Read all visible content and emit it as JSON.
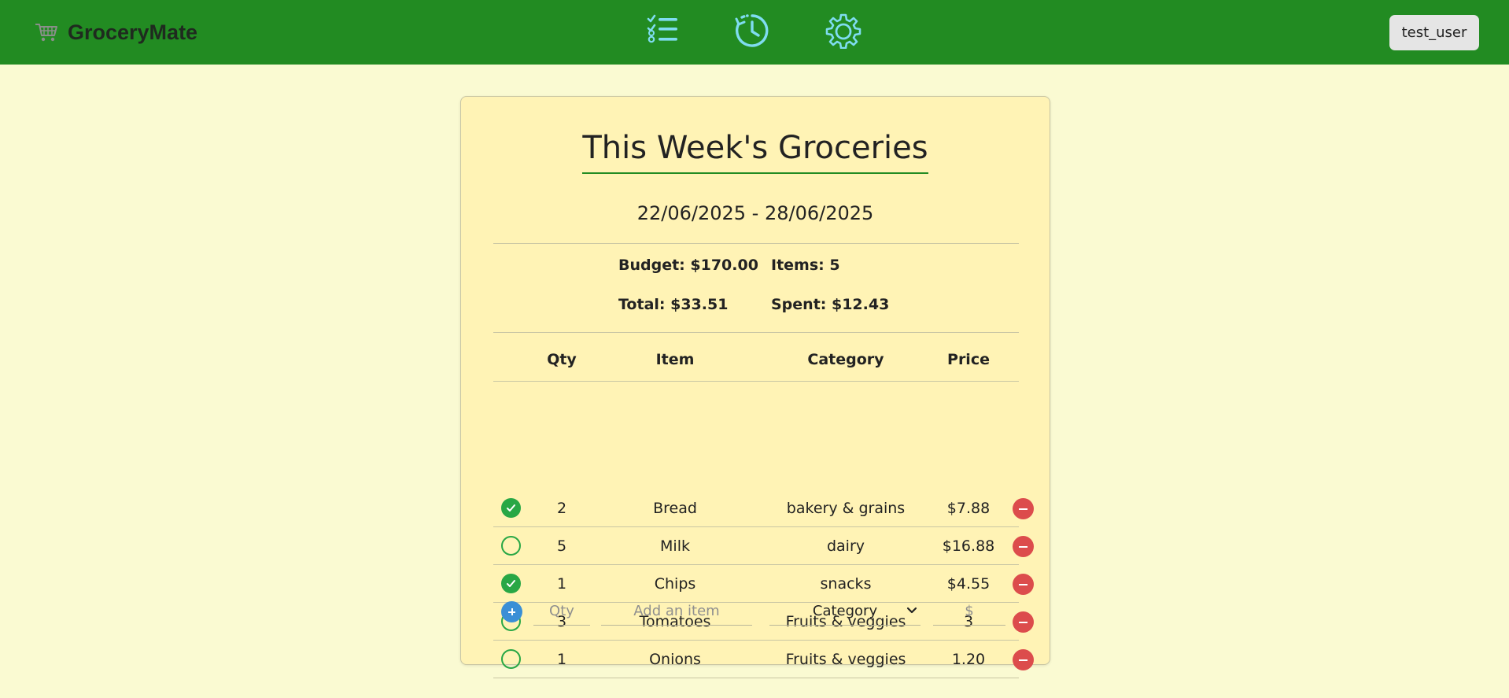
{
  "header": {
    "brand": "GroceryMate",
    "nav": [
      {
        "name": "list-icon"
      },
      {
        "name": "history-icon"
      },
      {
        "name": "settings-gear-icon"
      }
    ],
    "user_label": "test_user",
    "colors": {
      "bar": "#228b22",
      "nav_icon": "#7fdcf0"
    }
  },
  "card": {
    "title": "This Week's Groceries",
    "date_range": "22/06/2025 - 28/06/2025",
    "stats": {
      "budget": "Budget: $170.00",
      "items": "Items: 5",
      "total": "Total: $33.51",
      "spent": "Spent: $12.43"
    },
    "columns": {
      "qty": "Qty",
      "item": "Item",
      "category": "Category",
      "price": "Price"
    },
    "rows": [
      {
        "done": true,
        "qty": "2",
        "item": "Bread",
        "category": "bakery & grains",
        "price": "$7.88"
      },
      {
        "done": false,
        "qty": "5",
        "item": "Milk",
        "category": "dairy",
        "price": "$16.88"
      },
      {
        "done": true,
        "qty": "1",
        "item": "Chips",
        "category": "snacks",
        "price": "$4.55"
      },
      {
        "done": false,
        "qty": "3",
        "item": "Tomatoes",
        "category": "Fruits & veggies",
        "price": "3"
      },
      {
        "done": false,
        "qty": "1",
        "item": "Onions",
        "category": "Fruits & veggies",
        "price": "1.20"
      }
    ],
    "add_form": {
      "qty_placeholder": "Qty",
      "item_placeholder": "Add an item",
      "category_selected": "Category",
      "price_placeholder": "$"
    },
    "colors": {
      "done": "#28a745",
      "delete": "#dc4c4c",
      "add": "#3a8fd6",
      "accent_underline": "#228b22"
    }
  }
}
